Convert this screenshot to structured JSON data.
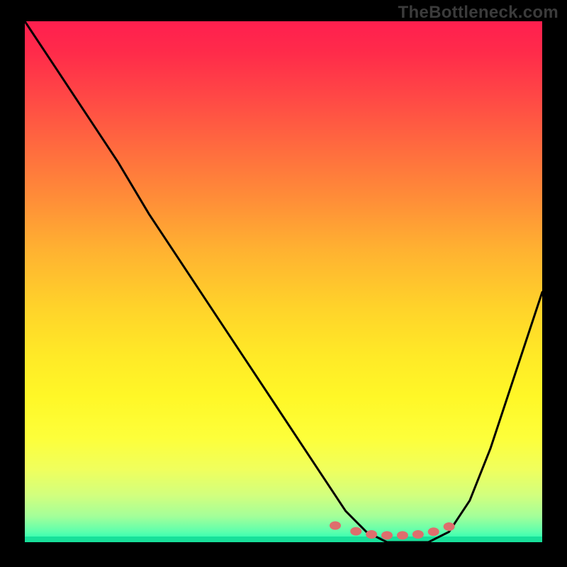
{
  "watermark": "TheBottleneck.com",
  "colors": {
    "frame_bg": "#000000",
    "curve_stroke": "#000000",
    "marker_fill": "#de6e6d",
    "bottom_band": "#18e09a",
    "gradient_top": "#ff1f4f",
    "gradient_bottom": "#1cffb3"
  },
  "chart_data": {
    "type": "line",
    "title": "",
    "xlabel": "",
    "ylabel": "",
    "xlim": [
      0,
      100
    ],
    "ylim": [
      0,
      100
    ],
    "grid": false,
    "legend": false,
    "series": [
      {
        "name": "bottleneck-curve",
        "x": [
          0,
          6,
          12,
          18,
          24,
          30,
          36,
          42,
          48,
          54,
          58,
          62,
          66,
          70,
          74,
          78,
          82,
          86,
          90,
          94,
          100
        ],
        "values": [
          100,
          91,
          82,
          73,
          63,
          54,
          45,
          36,
          27,
          18,
          12,
          6,
          2,
          0,
          0,
          0,
          2,
          8,
          18,
          30,
          48
        ]
      }
    ],
    "markers": {
      "name": "optimal-range-dots",
      "x": [
        60,
        64,
        67,
        70,
        73,
        76,
        79,
        82
      ],
      "values": [
        3.2,
        2.1,
        1.5,
        1.3,
        1.3,
        1.5,
        2.0,
        3.0
      ]
    },
    "annotations": []
  }
}
